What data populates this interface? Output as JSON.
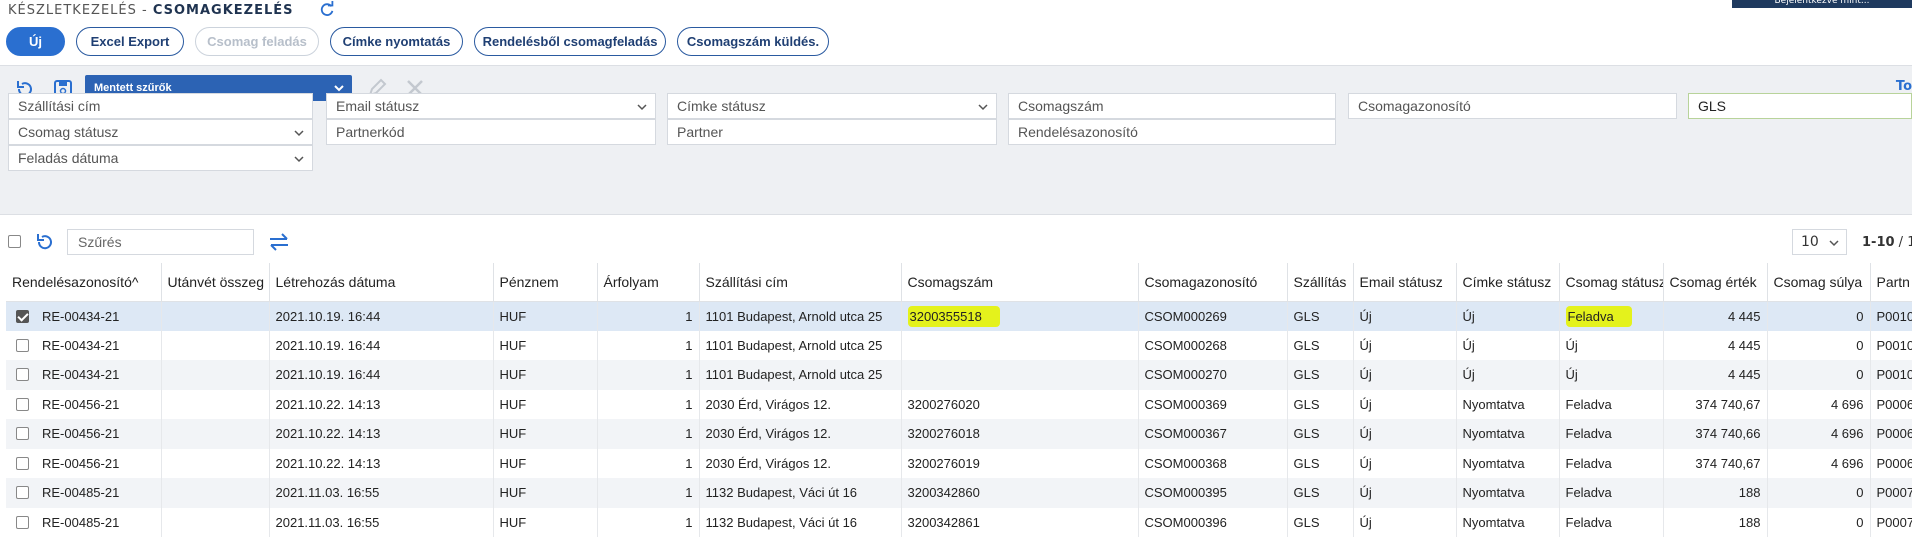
{
  "header": {
    "breadcrumb_parent": "KÉSZLETKEZELÉS -",
    "breadcrumb_current": "CSOMAGKEZELÉS",
    "login_badge": "Bejelentkezve mint..."
  },
  "actions": {
    "new": "Új",
    "excel_export": "Excel Export",
    "package_dispatch": "Csomag feladás",
    "label_print": "Címke nyomtatás",
    "order_dispatch": "Rendelésből csomagfeladás",
    "send_number": "Csomagszám küldés."
  },
  "filters": {
    "saved_filters": "Mentett szűrők",
    "right_link": "To",
    "shipping_address": "Szállítási cím",
    "email_status": "Email státusz",
    "label_status": "Címke státusz",
    "package_number": "Csomagszám",
    "package_id": "Csomagazonosító",
    "carrier_value": "GLS",
    "package_status": "Csomag státusz",
    "partner_code": "Partnerkód",
    "partner": "Partner",
    "order_id": "Rendelésazonosító",
    "dispatch_date": "Feladás dátuma"
  },
  "table_toolbar": {
    "search_placeholder": "Szűrés",
    "page_size": "10",
    "pager_range": "1-10",
    "pager_rest": " / 1"
  },
  "table": {
    "columns": [
      "Rendelésazonosító^",
      "Utánvét összeg",
      "Létrehozás dátuma",
      "Pénznem",
      "Árfolyam",
      "Szállítási cím",
      "Csomagszám",
      "Csomagazonosító",
      "Szállítás",
      "Email státusz",
      "Címke státusz",
      "Csomag státusz",
      "Csomag érték",
      "Csomag súlya",
      "Partn"
    ],
    "rows": [
      [
        "RE-00434-21",
        "",
        "2021.10.19. 16:44",
        "HUF",
        "1",
        "1101 Budapest, Arnold utca 25",
        "3200355518",
        "CSOM000269",
        "GLS",
        "Új",
        "Új",
        "Feladva",
        "4 445",
        "0",
        "P0010"
      ],
      [
        "RE-00434-21",
        "",
        "2021.10.19. 16:44",
        "HUF",
        "1",
        "1101 Budapest, Arnold utca 25",
        "",
        "CSOM000268",
        "GLS",
        "Új",
        "Új",
        "Új",
        "4 445",
        "0",
        "P0010"
      ],
      [
        "RE-00434-21",
        "",
        "2021.10.19. 16:44",
        "HUF",
        "1",
        "1101 Budapest, Arnold utca 25",
        "",
        "CSOM000270",
        "GLS",
        "Új",
        "Új",
        "Új",
        "4 445",
        "0",
        "P0010"
      ],
      [
        "RE-00456-21",
        "",
        "2021.10.22. 14:13",
        "HUF",
        "1",
        "2030 Érd, Virágos 12.",
        "3200276020",
        "CSOM000369",
        "GLS",
        "Új",
        "Nyomtatva",
        "Feladva",
        "374 740,67",
        "4 696",
        "P0006"
      ],
      [
        "RE-00456-21",
        "",
        "2021.10.22. 14:13",
        "HUF",
        "1",
        "2030 Érd, Virágos 12.",
        "3200276018",
        "CSOM000367",
        "GLS",
        "Új",
        "Nyomtatva",
        "Feladva",
        "374 740,66",
        "4 696",
        "P0006"
      ],
      [
        "RE-00456-21",
        "",
        "2021.10.22. 14:13",
        "HUF",
        "1",
        "2030 Érd, Virágos 12.",
        "3200276019",
        "CSOM000368",
        "GLS",
        "Új",
        "Nyomtatva",
        "Feladva",
        "374 740,67",
        "4 696",
        "P0006"
      ],
      [
        "RE-00485-21",
        "",
        "2021.11.03. 16:55",
        "HUF",
        "1",
        "1132 Budapest, Váci út 16",
        "3200342860",
        "CSOM000395",
        "GLS",
        "Új",
        "Nyomtatva",
        "Feladva",
        "188",
        "0",
        "P0007"
      ],
      [
        "RE-00485-21",
        "",
        "2021.11.03. 16:55",
        "HUF",
        "1",
        "1132 Budapest, Váci út 16",
        "3200342861",
        "CSOM000396",
        "GLS",
        "Új",
        "Nyomtatva",
        "Feladva",
        "188",
        "0",
        "P0007"
      ]
    ]
  },
  "colors": {
    "primary": "#2a6fd0",
    "highlight": "#e4f21c",
    "selected_row": "#dde8f5"
  }
}
